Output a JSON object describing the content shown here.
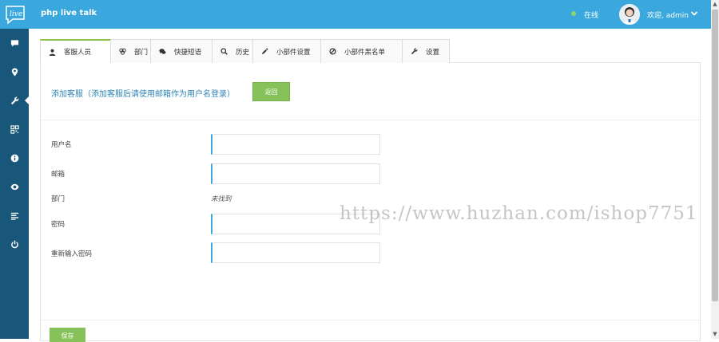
{
  "app": {
    "logo_text": "live",
    "title": "php live talk"
  },
  "header": {
    "status": "在线",
    "welcome": "欢迎, admin"
  },
  "sidebar": {
    "items": [
      "chat-icon",
      "location-icon",
      "wrench-icon",
      "qrcode-icon",
      "info-icon",
      "eye-icon",
      "list-icon",
      "power-icon"
    ],
    "active_index": 2
  },
  "tabs": [
    {
      "label": "客服人员",
      "icon": "user-icon",
      "active": true
    },
    {
      "label": "部门",
      "icon": "group-icon",
      "active": false
    },
    {
      "label": "快捷短语",
      "icon": "comments-icon",
      "active": false
    },
    {
      "label": "历史",
      "icon": "search-icon",
      "active": false
    },
    {
      "label": "小部件设置",
      "icon": "eyedropper-icon",
      "active": false
    },
    {
      "label": "小部件黑名单",
      "icon": "ban-icon",
      "active": false
    },
    {
      "label": "设置",
      "icon": "wrench-icon",
      "active": false
    }
  ],
  "form": {
    "heading": "添加客服（添加客服后请使用邮箱作为用户名登录）",
    "back_label": "返回",
    "fields": {
      "username": {
        "label": "用户名",
        "value": ""
      },
      "email": {
        "label": "邮箱",
        "value": ""
      },
      "department": {
        "label": "部门",
        "value": "未找到"
      },
      "password": {
        "label": "密码",
        "value": ""
      },
      "password_repeat": {
        "label": "重新输入密码",
        "value": ""
      }
    },
    "save_label": "保存"
  },
  "watermark": "https://www.huzhan.com/ishop7751",
  "colors": {
    "topbar": "#3aa8dc",
    "sidebar": "#19577a",
    "accent_green": "#86c159",
    "heading_blue": "#2f86b7"
  }
}
